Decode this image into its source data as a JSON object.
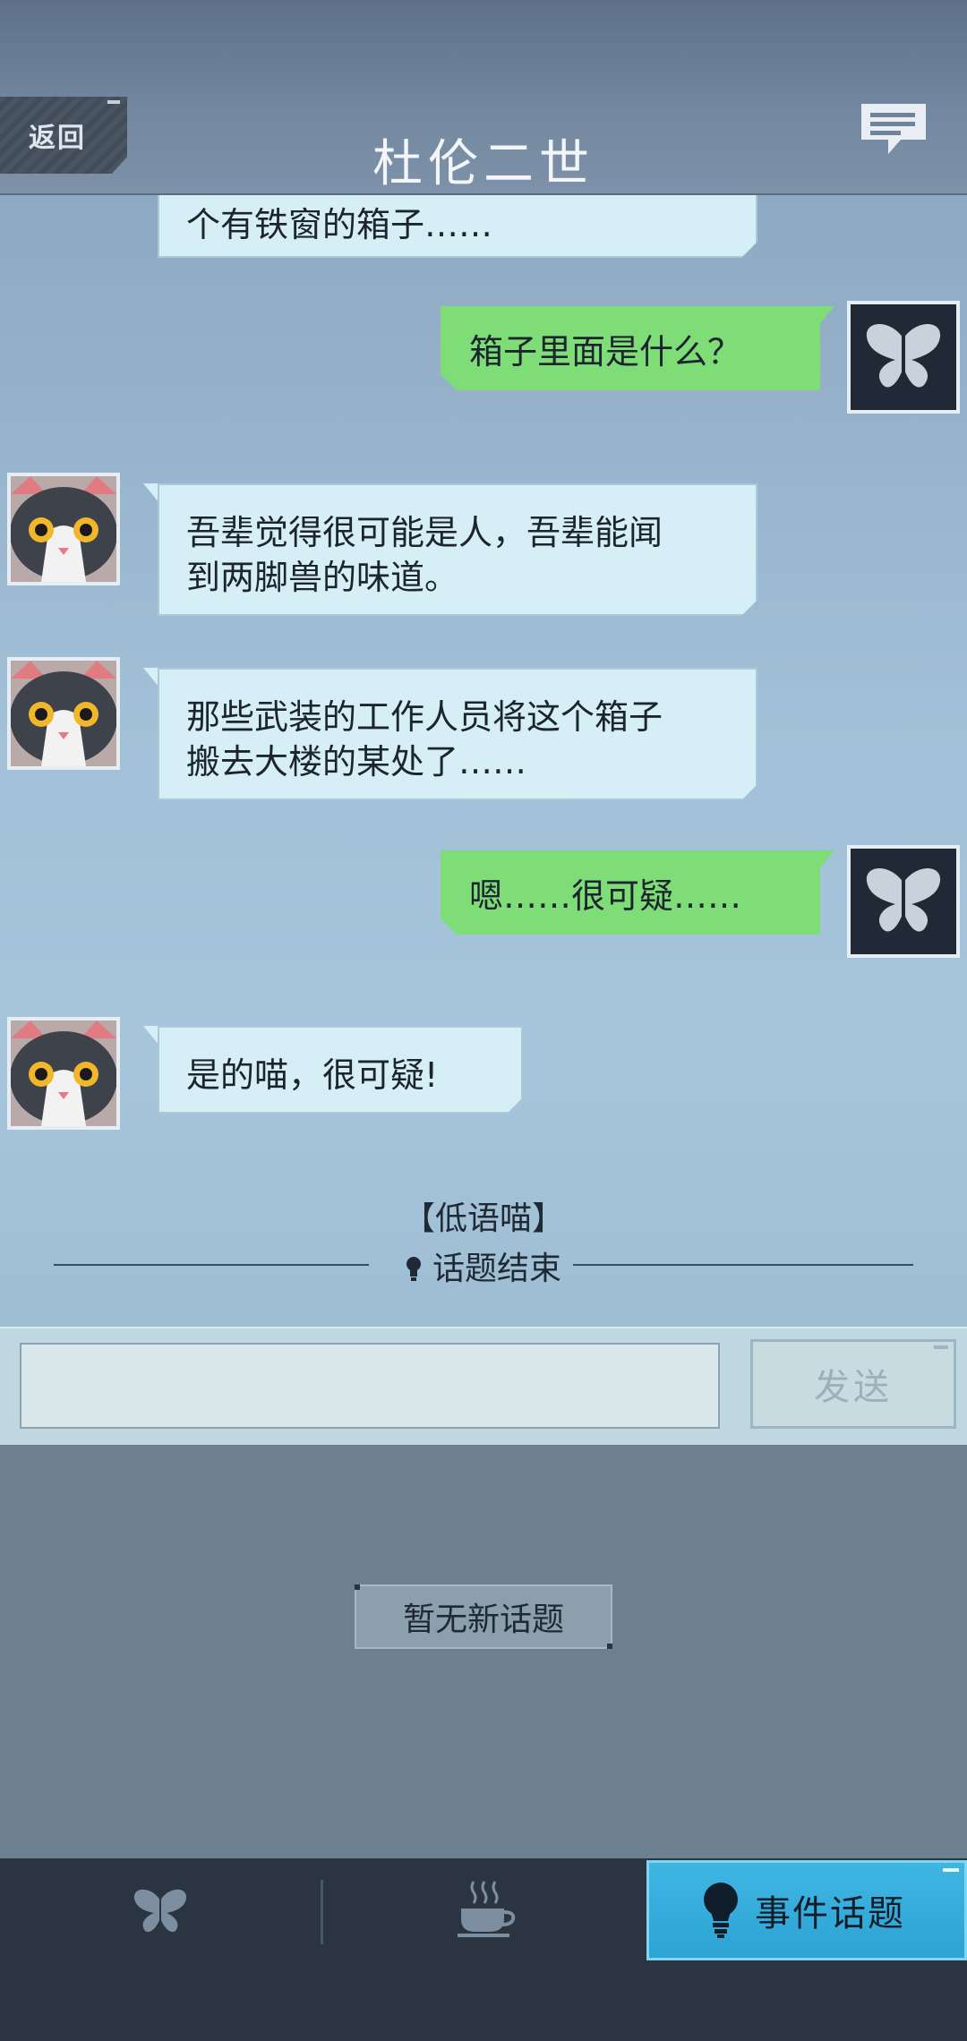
{
  "header": {
    "back_label": "返回",
    "title": "杜伦二世"
  },
  "messages": [
    {
      "side": "left",
      "text": "个有铁窗的箱子……"
    },
    {
      "side": "right",
      "text": "箱子里面是什么？"
    },
    {
      "side": "left",
      "line1": "吾辈觉得很可能是人，吾辈能闻",
      "line2": "到两脚兽的味道。"
    },
    {
      "side": "left",
      "line1": "那些武装的工作人员将这个箱子",
      "line2": "搬去大楼的某处了……"
    },
    {
      "side": "right",
      "text": "嗯……很可疑……"
    },
    {
      "side": "left",
      "text": "是的喵，很可疑!"
    }
  ],
  "system": {
    "speaker_tag": "【低语喵】",
    "topic_end": "话题结束"
  },
  "input": {
    "value": "",
    "send_label": "发送"
  },
  "topic_panel": {
    "empty_label": "暂无新话题"
  },
  "bottom_nav": {
    "items": [
      {
        "icon": "butterfly-icon",
        "label": ""
      },
      {
        "icon": "coffee-cup-icon",
        "label": ""
      },
      {
        "icon": "lightbulb-icon",
        "label": "事件话题",
        "active": true
      }
    ]
  },
  "colors": {
    "accent_blue": "#2da3d4",
    "my_bubble": "#7fdd78",
    "their_bubble": "#d6eef5"
  }
}
